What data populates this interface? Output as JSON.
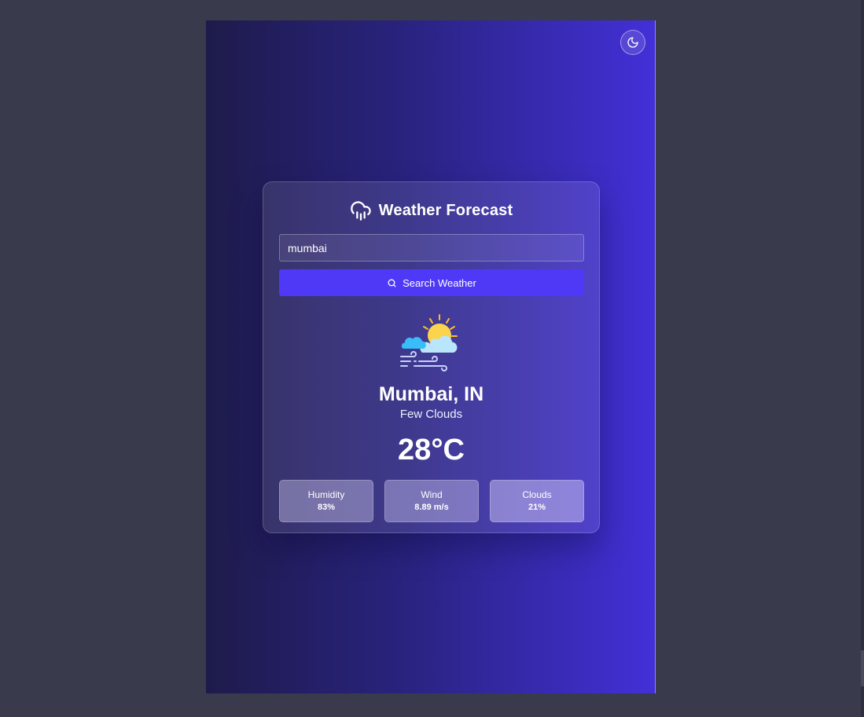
{
  "app": {
    "title": "Weather Forecast",
    "title_icon": "cloud-rain-icon",
    "theme_toggle_icon": "moon-icon"
  },
  "search": {
    "value": "mumbai",
    "button_label": "Search Weather",
    "button_icon": "search-icon"
  },
  "weather": {
    "icon": "sun-behind-cloud-wind-icon",
    "city": "Mumbai, IN",
    "description": "Few Clouds",
    "temperature": "28°C"
  },
  "stats": [
    {
      "label": "Humidity",
      "value": "83%"
    },
    {
      "label": "Wind",
      "value": "8.89 m/s"
    },
    {
      "label": "Clouds",
      "value": "21%"
    }
  ],
  "colors": {
    "page_background": "#393a4c",
    "gradient_start": "#1e1b4b",
    "gradient_end": "#4330d8",
    "button": "#4f39f6",
    "text": "#ffffff"
  }
}
